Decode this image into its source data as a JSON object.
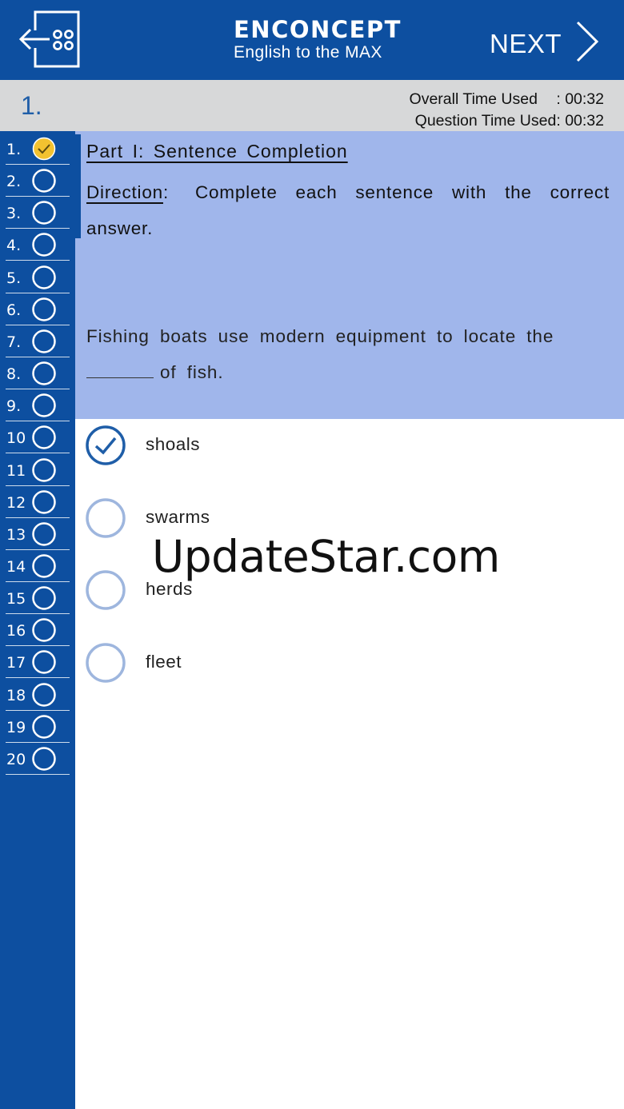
{
  "header": {
    "brand_name": "ENCONCEPT",
    "brand_tagline": "English to the MAX",
    "next_label": "NEXT",
    "background": "#0d4fa0"
  },
  "status": {
    "question_number": "1.",
    "overall_time_label": "Overall Time Used",
    "overall_time_value": ": 00:32",
    "question_time_label": "Question Time Used:",
    "question_time_value": "00:32"
  },
  "sidebar": {
    "items": [
      {
        "label": "1.",
        "answered": true
      },
      {
        "label": "2.",
        "answered": false
      },
      {
        "label": "3.",
        "answered": false
      },
      {
        "label": "4.",
        "answered": false
      },
      {
        "label": "5.",
        "answered": false
      },
      {
        "label": "6.",
        "answered": false
      },
      {
        "label": "7.",
        "answered": false
      },
      {
        "label": "8.",
        "answered": false
      },
      {
        "label": "9.",
        "answered": false
      },
      {
        "label": "10",
        "answered": false
      },
      {
        "label": "11",
        "answered": false
      },
      {
        "label": "12",
        "answered": false
      },
      {
        "label": "13",
        "answered": false
      },
      {
        "label": "14",
        "answered": false
      },
      {
        "label": "15",
        "answered": false
      },
      {
        "label": "16",
        "answered": false
      },
      {
        "label": "17",
        "answered": false
      },
      {
        "label": "18",
        "answered": false
      },
      {
        "label": "19",
        "answered": false
      },
      {
        "label": "20",
        "answered": false
      }
    ],
    "answered_color": "#f2c230"
  },
  "question": {
    "part_title": "Part I: Sentence Completion",
    "direction_label": "Direction",
    "direction_sep": ":",
    "direction_text": "Complete each sentence with the correct answer.",
    "stem_before": "Fishing boats use modern equipment to locate the",
    "stem_after": "of fish.",
    "background": "#a0b6eb"
  },
  "options": [
    {
      "text": "shoals",
      "selected": true
    },
    {
      "text": "swarms",
      "selected": false
    },
    {
      "text": "herds",
      "selected": false
    },
    {
      "text": "fleet",
      "selected": false
    }
  ],
  "watermark": "UpdateStar.com"
}
